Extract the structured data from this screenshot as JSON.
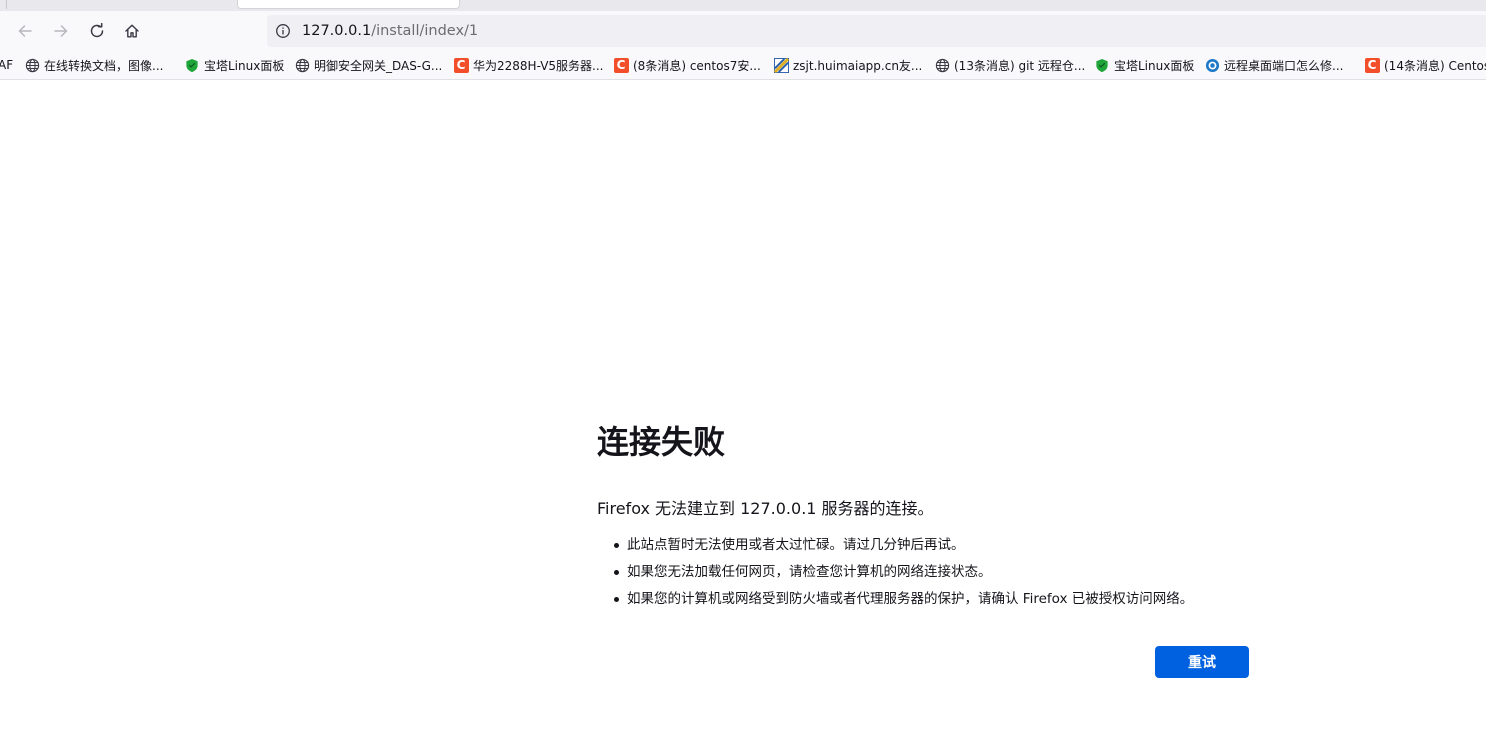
{
  "browser": {
    "url": {
      "host": "127.0.0.1",
      "path": "/install/index/1"
    },
    "bookmarks": [
      {
        "icon": "globe-icon",
        "label": "在线转换文档，图像..."
      },
      {
        "icon": "baota-shield-icon",
        "label": "宝塔Linux面板"
      },
      {
        "icon": "globe-icon",
        "label": "明御安全网关_DAS-G..."
      },
      {
        "icon": "csdn-c-icon",
        "label": "华为2288H-V5服务器..."
      },
      {
        "icon": "csdn-c-icon",
        "label": "(8条消息) centos7安..."
      },
      {
        "icon": "site-favicon-icon",
        "label": "zsjt.huimaiapp.cn友..."
      },
      {
        "icon": "globe-icon",
        "label": "(13条消息) git 远程仓..."
      },
      {
        "icon": "baota-shield-icon",
        "label": "宝塔Linux面板"
      },
      {
        "icon": "remote-desktop-icon",
        "label": "远程桌面端口怎么修..."
      },
      {
        "icon": "csdn-c-icon",
        "label": "(14条消息) Centos"
      }
    ],
    "bookmark_cut_label": "AF",
    "csdn_letter": "C"
  },
  "error": {
    "title": "连接失败",
    "description": "Firefox 无法建立到 127.0.0.1 服务器的连接。",
    "tips": [
      "此站点暂时无法使用或者太过忙碌。请过几分钟后再试。",
      "如果您无法加载任何网页，请检查您计算机的网络连接状态。",
      "如果您的计算机或网络受到防火墙或者代理服务器的保护，请确认 Firefox 已被授权访问网络。"
    ],
    "retry_label": "重试"
  },
  "colors": {
    "accent": "#0061e0",
    "csdn": "#f24e29",
    "baota": "#20a53a"
  }
}
